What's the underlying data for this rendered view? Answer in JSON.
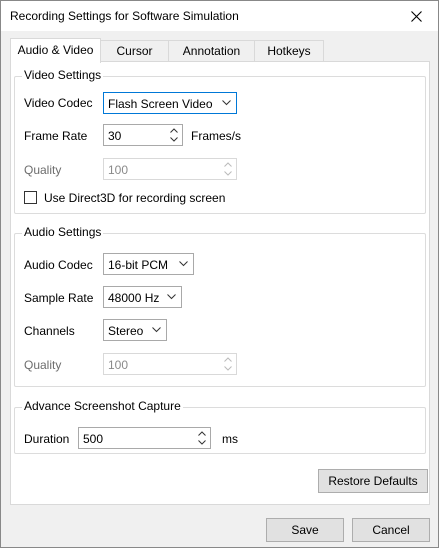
{
  "window": {
    "title": "Recording Settings for Software Simulation",
    "close_icon": "close-icon"
  },
  "tabs": [
    {
      "label": "Audio & Video",
      "active": true
    },
    {
      "label": "Cursor",
      "active": false
    },
    {
      "label": "Annotation",
      "active": false
    },
    {
      "label": "Hotkeys",
      "active": false
    }
  ],
  "video_settings": {
    "title": "Video Settings",
    "codec_label": "Video Codec",
    "codec_value": "Flash Screen Video",
    "frame_rate_label": "Frame Rate",
    "frame_rate_value": "30",
    "frame_rate_unit": "Frames/s",
    "quality_label": "Quality",
    "quality_value": "100",
    "direct3d_label": "Use Direct3D for recording screen",
    "direct3d_checked": false
  },
  "audio_settings": {
    "title": "Audio Settings",
    "codec_label": "Audio Codec",
    "codec_value": "16-bit PCM",
    "sample_rate_label": "Sample Rate",
    "sample_rate_value": "48000 Hz",
    "channels_label": "Channels",
    "channels_value": "Stereo",
    "quality_label": "Quality",
    "quality_value": "100"
  },
  "screenshot_capture": {
    "title": "Advance Screenshot Capture",
    "duration_label": "Duration",
    "duration_value": "500",
    "duration_unit": "ms"
  },
  "buttons": {
    "restore_defaults": "Restore Defaults",
    "save": "Save",
    "cancel": "Cancel"
  },
  "colors": {
    "accent": "#0078d7",
    "background": "#f0f0f0",
    "panel": "#ffffff"
  }
}
